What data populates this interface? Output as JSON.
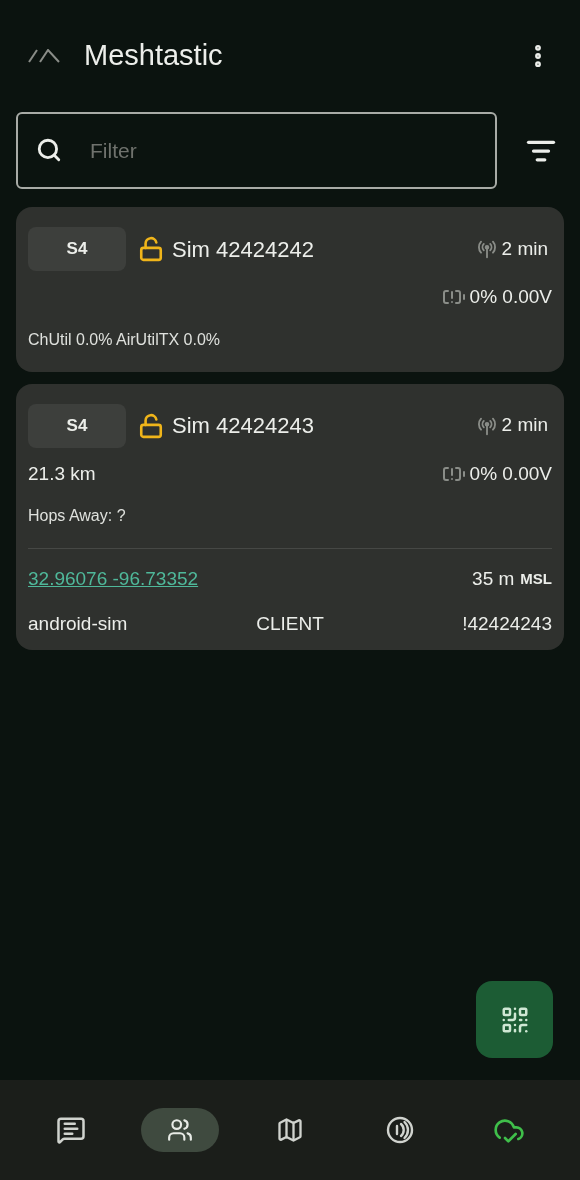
{
  "app_bar": {
    "title": "Meshtastic"
  },
  "filter": {
    "placeholder": "Filter"
  },
  "nodes": [
    {
      "short_name": "S4",
      "long_name": "Sim 42424242",
      "last_heard": "2 min",
      "battery": "0% 0.00V",
      "channel_util": "ChUtil 0.0% AirUtilTX 0.0%"
    },
    {
      "short_name": "S4",
      "long_name": "Sim 42424243",
      "last_heard": "2 min",
      "battery": "0% 0.00V",
      "distance": "21.3 km",
      "hops": "Hops Away: ?",
      "position": "32.96076 -96.73352",
      "altitude": "35 m",
      "altitude_unit": "MSL",
      "hardware": "android-sim",
      "role": "CLIENT",
      "node_id": "!42424243"
    }
  ],
  "nav": [
    {
      "kind": "messages",
      "selected": false
    },
    {
      "kind": "nodes",
      "selected": true
    },
    {
      "kind": "map",
      "selected": false
    },
    {
      "kind": "radio",
      "selected": false
    },
    {
      "kind": "connection",
      "selected": false
    }
  ]
}
